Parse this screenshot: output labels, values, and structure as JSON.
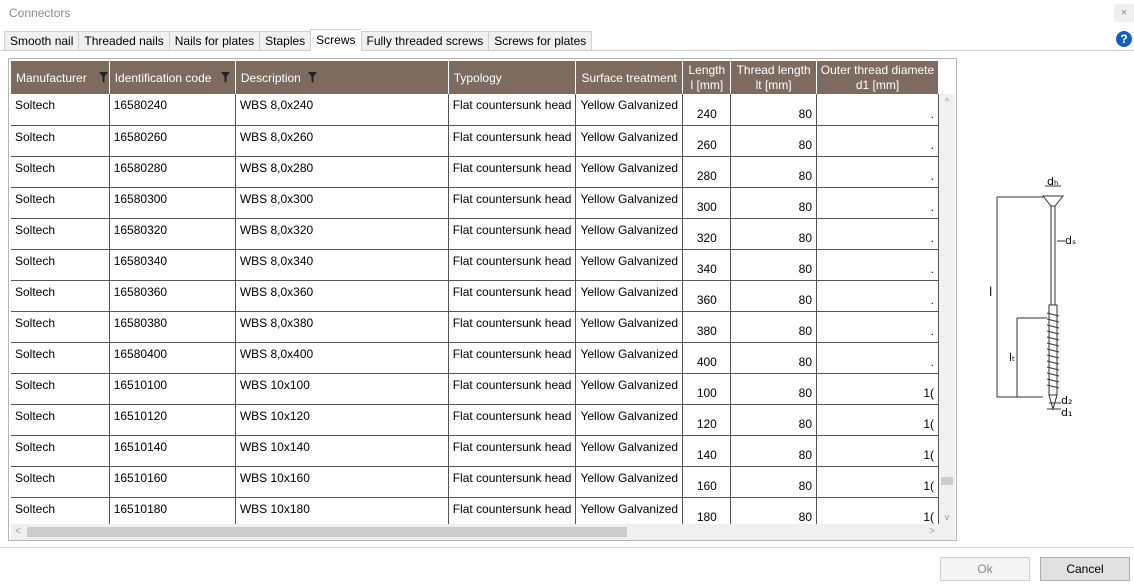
{
  "window": {
    "title": "Connectors",
    "close": "×"
  },
  "tabs": [
    {
      "label": "Smooth nail",
      "active": false
    },
    {
      "label": "Threaded nails",
      "active": false
    },
    {
      "label": "Nails for plates",
      "active": false
    },
    {
      "label": "Staples",
      "active": false
    },
    {
      "label": "Screws",
      "active": true
    },
    {
      "label": "Fully threaded screws",
      "active": false
    },
    {
      "label": "Screws for plates",
      "active": false
    }
  ],
  "help": "?",
  "table": {
    "columns": [
      {
        "line1": "Manufacturer",
        "line2": "",
        "filter": true
      },
      {
        "line1": "Identification code",
        "line2": "",
        "filter": true
      },
      {
        "line1": "Description",
        "line2": "",
        "filter": true
      },
      {
        "line1": "Typology",
        "line2": "",
        "filter": false
      },
      {
        "line1": "Surface treatment",
        "line2": "",
        "filter": false
      },
      {
        "line1": "Length",
        "line2": "l [mm]",
        "filter": false
      },
      {
        "line1": "Thread length",
        "line2": "lt [mm]",
        "filter": false
      },
      {
        "line1": "Outer thread diamete",
        "line2": "d1 [mm]",
        "filter": false
      }
    ],
    "rows": [
      {
        "manufacturer": "Soltech",
        "code": "16580240",
        "description": "WBS 8,0x240",
        "typology": "Flat countersunk head",
        "surface": "Yellow Galvanized",
        "length": "240",
        "thread": "80",
        "d1": "."
      },
      {
        "manufacturer": "Soltech",
        "code": "16580260",
        "description": "WBS 8,0x260",
        "typology": "Flat countersunk head",
        "surface": "Yellow Galvanized",
        "length": "260",
        "thread": "80",
        "d1": "."
      },
      {
        "manufacturer": "Soltech",
        "code": "16580280",
        "description": "WBS 8,0x280",
        "typology": "Flat countersunk head",
        "surface": "Yellow Galvanized",
        "length": "280",
        "thread": "80",
        "d1": "."
      },
      {
        "manufacturer": "Soltech",
        "code": "16580300",
        "description": "WBS 8,0x300",
        "typology": "Flat countersunk head",
        "surface": "Yellow Galvanized",
        "length": "300",
        "thread": "80",
        "d1": "."
      },
      {
        "manufacturer": "Soltech",
        "code": "16580320",
        "description": "WBS 8,0x320",
        "typology": "Flat countersunk head",
        "surface": "Yellow Galvanized",
        "length": "320",
        "thread": "80",
        "d1": "."
      },
      {
        "manufacturer": "Soltech",
        "code": "16580340",
        "description": "WBS 8,0x340",
        "typology": "Flat countersunk head",
        "surface": "Yellow Galvanized",
        "length": "340",
        "thread": "80",
        "d1": "."
      },
      {
        "manufacturer": "Soltech",
        "code": "16580360",
        "description": "WBS 8,0x360",
        "typology": "Flat countersunk head",
        "surface": "Yellow Galvanized",
        "length": "360",
        "thread": "80",
        "d1": "."
      },
      {
        "manufacturer": "Soltech",
        "code": "16580380",
        "description": "WBS 8,0x380",
        "typology": "Flat countersunk head",
        "surface": "Yellow Galvanized",
        "length": "380",
        "thread": "80",
        "d1": "."
      },
      {
        "manufacturer": "Soltech",
        "code": "16580400",
        "description": "WBS 8,0x400",
        "typology": "Flat countersunk head",
        "surface": "Yellow Galvanized",
        "length": "400",
        "thread": "80",
        "d1": "."
      },
      {
        "manufacturer": "Soltech",
        "code": "16510100",
        "description": "WBS 10x100",
        "typology": "Flat countersunk head",
        "surface": "Yellow Galvanized",
        "length": "100",
        "thread": "80",
        "d1": "1("
      },
      {
        "manufacturer": "Soltech",
        "code": "16510120",
        "description": "WBS 10x120",
        "typology": "Flat countersunk head",
        "surface": "Yellow Galvanized",
        "length": "120",
        "thread": "80",
        "d1": "1("
      },
      {
        "manufacturer": "Soltech",
        "code": "16510140",
        "description": "WBS 10x140",
        "typology": "Flat countersunk head",
        "surface": "Yellow Galvanized",
        "length": "140",
        "thread": "80",
        "d1": "1("
      },
      {
        "manufacturer": "Soltech",
        "code": "16510160",
        "description": "WBS 10x160",
        "typology": "Flat countersunk head",
        "surface": "Yellow Galvanized",
        "length": "160",
        "thread": "80",
        "d1": "1("
      },
      {
        "manufacturer": "Soltech",
        "code": "16510180",
        "description": "WBS 10x180",
        "typology": "Flat countersunk head",
        "surface": "Yellow Galvanized",
        "length": "180",
        "thread": "80",
        "d1": "1("
      }
    ]
  },
  "diagram": {
    "labels": {
      "dh": "dₕ",
      "ds": "dₛ",
      "l": "l",
      "lt": "lₜ",
      "d2": "d₂",
      "d1": "d₁"
    }
  },
  "buttons": {
    "ok": "Ok",
    "cancel": "Cancel"
  },
  "colors": {
    "header_bg": "#7e6b60",
    "help_icon": "#1a5fb4"
  },
  "scroll": {
    "up": "^",
    "down": "v",
    "left": "<",
    "right": ">"
  }
}
